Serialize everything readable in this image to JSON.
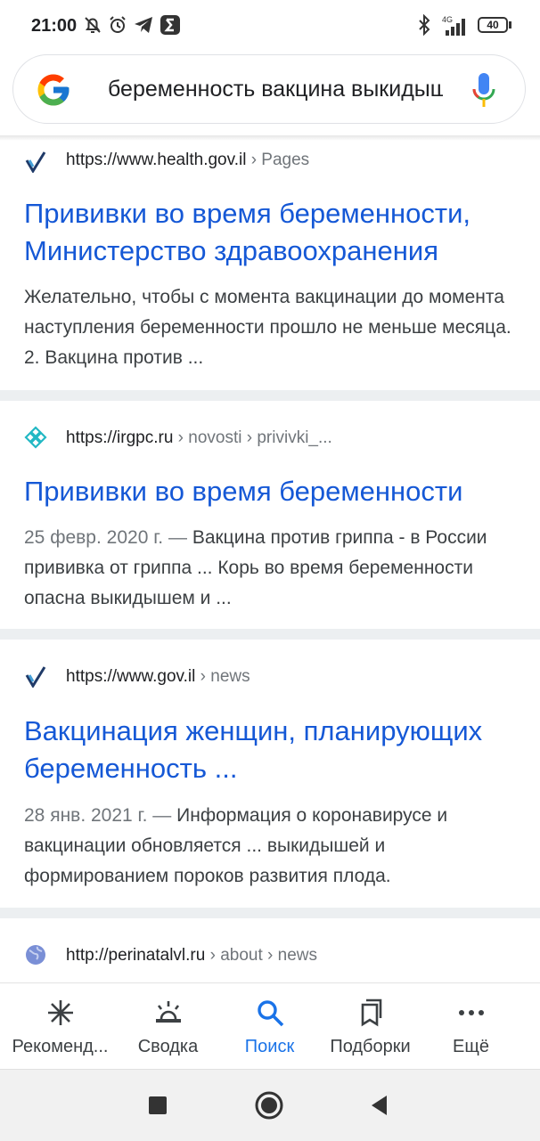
{
  "status_bar": {
    "time": "21:00",
    "network": "4G",
    "battery": "40"
  },
  "search": {
    "query": "беременность вакцина выкидыш"
  },
  "results": [
    {
      "url_host": "https://www.health.gov.il",
      "url_path": " › Pages",
      "title": "Прививки во время беременности, Министерство здравоохранения",
      "date": "",
      "snippet": "Желательно, чтобы с момента вакцинации до момента наступления беременности прошло не меньше месяца. 2. Вакцина против ..."
    },
    {
      "url_host": "https://irgpc.ru",
      "url_path": " › novosti › privivki_...",
      "title": "Прививки во время беременности",
      "date": "25 февр. 2020 г. — ",
      "snippet": "Вакцина против гриппа - в России прививка от гриппа ... Корь во время беременности опасна выкидышем и ..."
    },
    {
      "url_host": "https://www.gov.il",
      "url_path": " › news",
      "title": "Вакцинация женщин, планирующих беременность ...",
      "date": "28 янв. 2021 г. — ",
      "snippet": "Информация о коронавирусе и вакцинации обновляется ... выкидышей и формированием пороков развития плода."
    },
    {
      "url_host": "http://perinatalvl.ru",
      "url_path": " › about › news"
    }
  ],
  "bottom_nav": {
    "items": [
      {
        "label": "Рекоменд...",
        "icon": "asterisk-icon"
      },
      {
        "label": "Сводка",
        "icon": "sunrise-icon"
      },
      {
        "label": "Поиск",
        "icon": "search-icon"
      },
      {
        "label": "Подборки",
        "icon": "bookmarks-icon"
      },
      {
        "label": "Ещё",
        "icon": "more-dots-icon"
      }
    ],
    "active_index": 2
  },
  "colors": {
    "link": "#1558d6",
    "accent": "#1a73e8",
    "text": "#202124",
    "muted": "#70757a"
  }
}
